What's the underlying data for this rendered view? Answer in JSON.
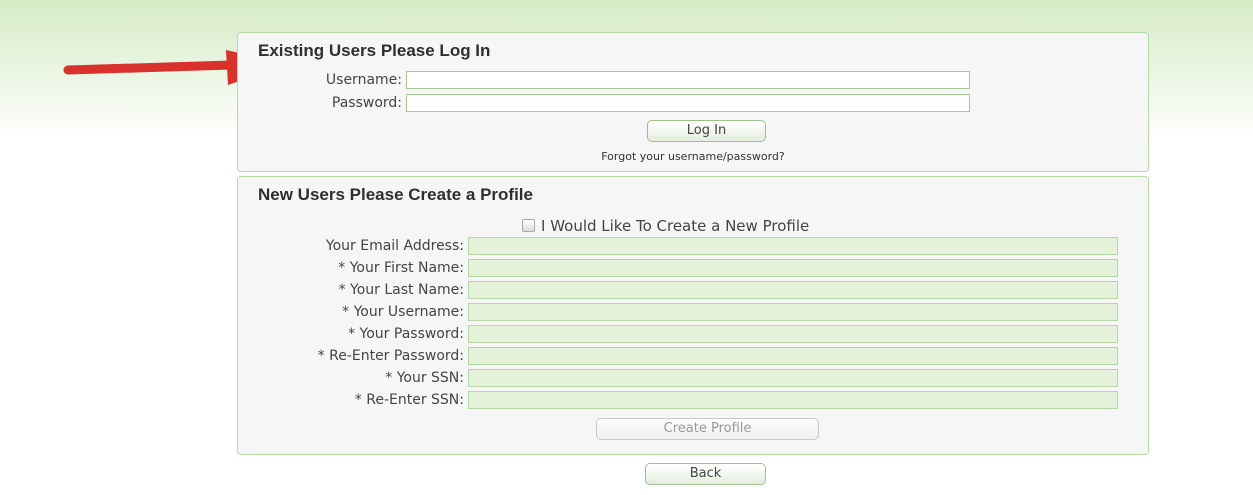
{
  "login": {
    "title": "Existing Users Please Log In",
    "username_label": "Username:",
    "username_value": "",
    "password_label": "Password:",
    "password_value": "",
    "login_button": "Log In",
    "forgot_link": "Forgot your username/password?"
  },
  "profile": {
    "title": "New Users Please Create a Profile",
    "checkbox_label": "I Would Like To Create a New Profile",
    "checkbox_checked": false,
    "fields": [
      {
        "label": "Your Email Address:",
        "value": ""
      },
      {
        "label": "* Your First Name:",
        "value": ""
      },
      {
        "label": "* Your Last Name:",
        "value": ""
      },
      {
        "label": "* Your Username:",
        "value": ""
      },
      {
        "label": "* Your Password:",
        "value": ""
      },
      {
        "label": "* Re-Enter Password:",
        "value": ""
      },
      {
        "label": "* Your SSN:",
        "value": ""
      },
      {
        "label": "* Re-Enter SSN:",
        "value": ""
      }
    ],
    "create_button": "Create Profile"
  },
  "back_button": "Back",
  "colors": {
    "arrow": "#d9312b",
    "panel_border": "#b7d9a7",
    "field_fill": "#e3f2d9"
  }
}
